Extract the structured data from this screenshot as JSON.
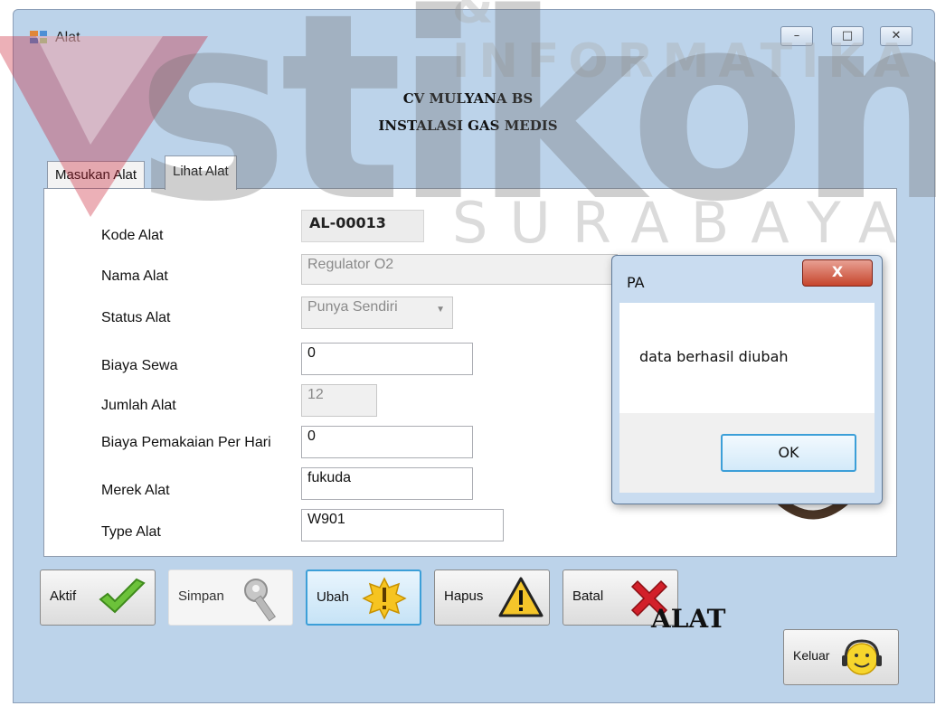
{
  "window": {
    "title": "Alat",
    "min_glyph": "–",
    "max_glyph": "□",
    "close_glyph": "✕"
  },
  "header": {
    "company": "CV MULYANA BS",
    "subtitle": "INSTALASI GAS MEDIS"
  },
  "tabs": [
    {
      "label": "Masukan Alat"
    },
    {
      "label": "Lihat Alat"
    }
  ],
  "form": {
    "kode_label": "Kode Alat",
    "kode_value": "AL-00013",
    "nama_label": "Nama Alat",
    "nama_value": "Regulator O2",
    "status_label": "Status Alat",
    "status_value": "Punya Sendiri",
    "biaya_sewa_label": "Biaya Sewa",
    "biaya_sewa_value": "0",
    "jumlah_label": "Jumlah Alat",
    "jumlah_value": "12",
    "biaya_pakai_label": "Biaya Pemakaian Per Hari",
    "biaya_pakai_value": "0",
    "merek_label": "Merek Alat",
    "merek_value": "fukuda",
    "type_label": "Type Alat",
    "type_value": "W901"
  },
  "toolbar": {
    "aktif": "Aktif",
    "simpan": "Simpan",
    "ubah": "Ubah",
    "hapus": "Hapus",
    "batal": "Batal",
    "keluar": "Keluar"
  },
  "footer_title": "ALAT",
  "dialog": {
    "title": "PA",
    "message": "data berhasil diubah",
    "ok": "OK",
    "close_glyph": "X"
  },
  "watermark": {
    "top": "& INFORMATIKA",
    "main": "stikom",
    "bottom": "SURABAYA"
  },
  "colors": {
    "window_bg": "#bfd4ea",
    "accent_focus": "#3c9fd8",
    "close_red": "#c6452c"
  }
}
